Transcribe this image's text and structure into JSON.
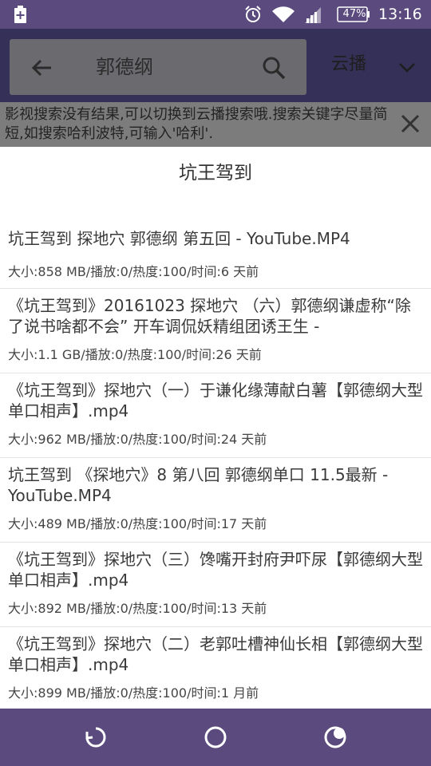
{
  "status_bar": {
    "battery_percent": "47%",
    "time": "13:16",
    "icons": [
      "battery-charging-icon",
      "alarm-icon",
      "wifi-icon",
      "signal-icon",
      "battery-icon"
    ]
  },
  "search": {
    "query": "郭德纲",
    "source_label": "云播"
  },
  "tip": {
    "text": "影视搜索没有结果,可以切换到云播搜索哦.搜索关键字尽量简短,如搜索哈利波特,可输入'哈利'."
  },
  "dialog": {
    "title": "坑王驾到",
    "results": [
      {
        "title": "坑王驾到 探地穴 郭德纲 第五回  - YouTube.MP4",
        "meta": "大小:858 MB/播放:0/热度:100/时间:6 天前"
      },
      {
        "title": "《坑王驾到》20161023 探地穴 （六）郭德纲谦虚称“除了说书啥都不会” 开车调侃妖精组团诱王生 -",
        "meta": "大小:1.1 GB/播放:0/热度:100/时间:26 天前"
      },
      {
        "title": "《坑王驾到》探地穴（一）于谦化缘薄献白薯【郭德纲大型单口相声】.mp4",
        "meta": "大小:962 MB/播放:0/热度:100/时间:24 天前"
      },
      {
        "title": "坑王驾到 《探地穴》8 第八回 郭德纲单口 11.5最新 - YouTube.MP4",
        "meta": "大小:489 MB/播放:0/热度:100/时间:17 天前"
      },
      {
        "title": "《坑王驾到》探地穴（三）馋嘴开封府尹吓尿【郭德纲大型单口相声】.mp4",
        "meta": "大小:892 MB/播放:0/热度:100/时间:13 天前"
      },
      {
        "title": "《坑王驾到》探地穴（二）老郭吐槽神仙长相【郭德纲大型单口相声】.mp4",
        "meta": "大小:899 MB/播放:0/热度:100/时间:1 月前"
      }
    ]
  },
  "colors": {
    "bar": "#5b4a7d",
    "appbar_dimmed": "#353057",
    "dialog_bg": "#ffffff"
  }
}
